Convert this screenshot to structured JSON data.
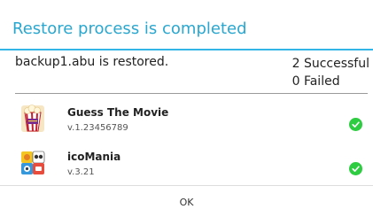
{
  "dialog": {
    "title": "Restore process is completed",
    "message": "backup1.abu is restored.",
    "successful": "2 Successful",
    "failed": "0 Failed",
    "ok_label": "OK",
    "accent_color": "#33b5e5",
    "success_color": "#2ecc40"
  },
  "apps": [
    {
      "name": "Guess The Movie",
      "version": "v.1.23456789",
      "icon": "guess-the-movie-app-icon",
      "status": "check-icon"
    },
    {
      "name": "icoMania",
      "version": "v.3.21",
      "icon": "icomania-app-icon",
      "status": "check-icon"
    }
  ]
}
